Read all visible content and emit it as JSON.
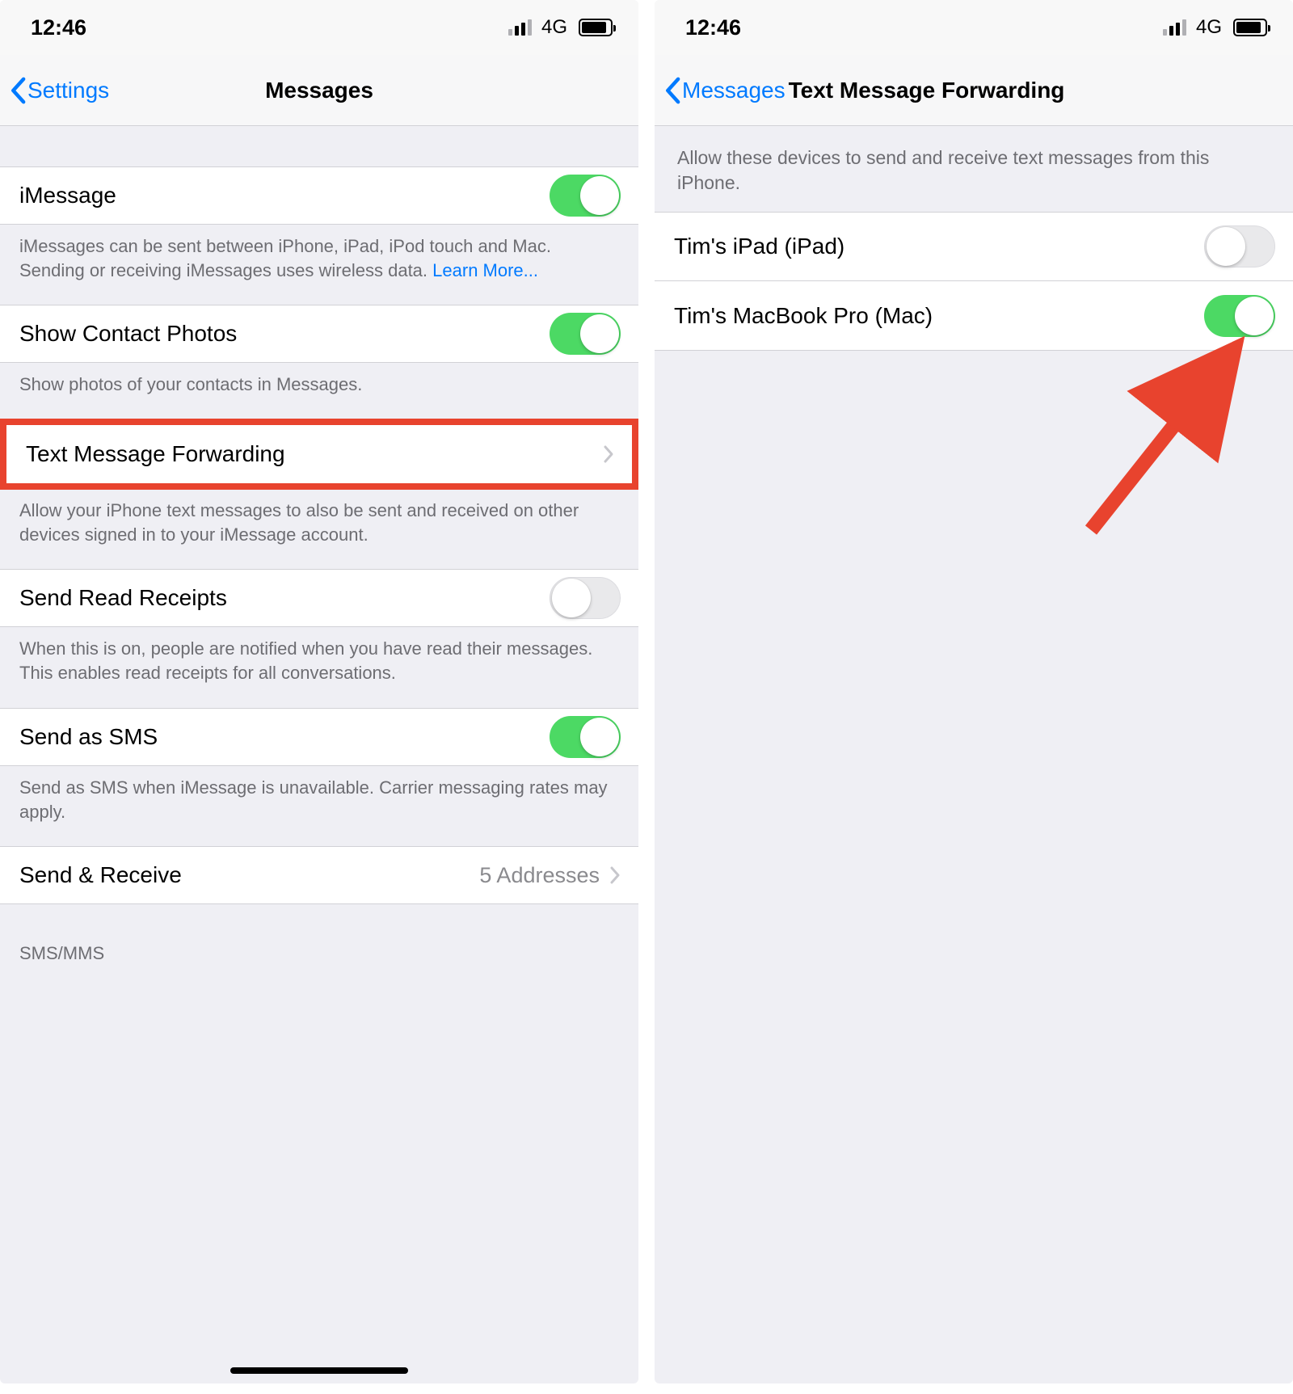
{
  "status": {
    "time": "12:46",
    "network_label": "4G"
  },
  "left": {
    "nav": {
      "back_label": "Settings",
      "title": "Messages"
    },
    "imessage": {
      "label": "iMessage",
      "on": true,
      "footer_a": "iMessages can be sent between iPhone, iPad, iPod touch and Mac. Sending or receiving iMessages uses wireless data. ",
      "footer_link": "Learn More..."
    },
    "contact_photos": {
      "label": "Show Contact Photos",
      "on": true,
      "footer": "Show photos of your contacts in Messages."
    },
    "forwarding": {
      "label": "Text Message Forwarding",
      "footer": "Allow your iPhone text messages to also be sent and received on other devices signed in to your iMessage account."
    },
    "read_receipts": {
      "label": "Send Read Receipts",
      "on": false,
      "footer": "When this is on, people are notified when you have read their messages. This enables read receipts for all conversations."
    },
    "send_sms": {
      "label": "Send as SMS",
      "on": true,
      "footer": "Send as SMS when iMessage is unavailable. Carrier messaging rates may apply."
    },
    "send_receive": {
      "label": "Send & Receive",
      "value": "5 Addresses"
    },
    "sms_header": "SMS/MMS"
  },
  "right": {
    "nav": {
      "back_label": "Messages",
      "title": "Text Message Forwarding"
    },
    "help": "Allow these devices to send and receive text messages from this iPhone.",
    "devices": {
      "ipad": {
        "label": "Tim's iPad (iPad)",
        "on": false
      },
      "mac": {
        "label": "Tim's MacBook Pro (Mac)",
        "on": true
      }
    }
  },
  "colors": {
    "accent": "#007aff",
    "switch_on": "#4cd964",
    "highlight": "#e8432e"
  }
}
